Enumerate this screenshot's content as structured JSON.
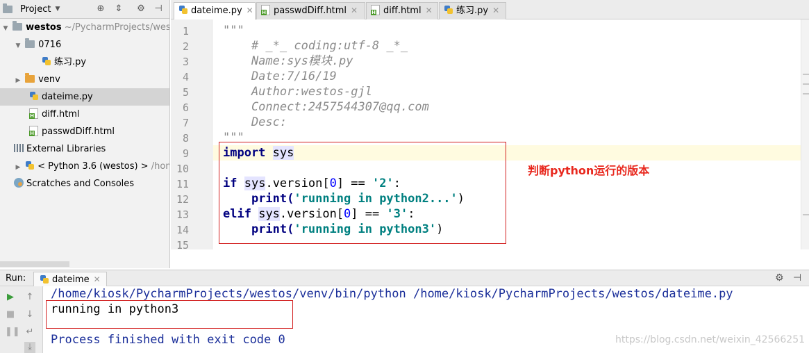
{
  "project_panel": {
    "title": "Project",
    "tree": [
      {
        "label": "westos",
        "suffix": " ~/PycharmProjects/westos"
      },
      {
        "label": "0716"
      },
      {
        "label": "练习.py"
      },
      {
        "label": "venv"
      },
      {
        "label": "dateime.py"
      },
      {
        "label": "diff.html"
      },
      {
        "label": "passwdDiff.html"
      },
      {
        "label": "External Libraries"
      },
      {
        "label": "< Python 3.6 (westos) >",
        "suffix": " /home/kiosk"
      },
      {
        "label": "Scratches and Consoles"
      }
    ]
  },
  "tabs": [
    {
      "label": "dateime.py"
    },
    {
      "label": "passwdDiff.html"
    },
    {
      "label": "diff.html"
    },
    {
      "label": "练习.py"
    }
  ],
  "editor": {
    "line_numbers": [
      "1",
      "2",
      "3",
      "4",
      "5",
      "6",
      "7",
      "8",
      "9",
      "10",
      "11",
      "12",
      "13",
      "14",
      "15"
    ],
    "doc": {
      "open": "\"\"\"",
      "l2": "    # _*_ coding:utf-8 _*_",
      "l3": "    Name:sys模块.py",
      "l4": "    Date:7/16/19",
      "l5": "    Author:westos-gjl",
      "l6": "    Connect:2457544307@qq.com",
      "l7": "    Desc:",
      "close": "\"\"\""
    },
    "code": {
      "import_kw": "import",
      "sys": "sys",
      "if_kw": "if",
      "version": ".version[",
      "idx": "0",
      "cmp": "] == ",
      "two": "'2'",
      "colon": ":",
      "indent": "    ",
      "print": "print(",
      "msg2": "'running in python2...'",
      "rparen": ")",
      "elif_kw": "elif",
      "three": "'3'",
      "msg3": "'running in python3'"
    },
    "annotation": "判断python运行的版本"
  },
  "run_panel": {
    "label": "Run:",
    "tab": "dateime",
    "command": "/home/kiosk/PycharmProjects/westos/venv/bin/python /home/kiosk/PycharmProjects/westos/dateime.py",
    "output": "running in python3",
    "exit": "Process finished with exit code 0"
  },
  "watermark": "https://blog.csdn.net/weixin_42566251",
  "colors": {
    "keyword": "#000080",
    "string": "#008080",
    "annotation": "#e8281e",
    "highlight_box": "#d21e1e"
  }
}
